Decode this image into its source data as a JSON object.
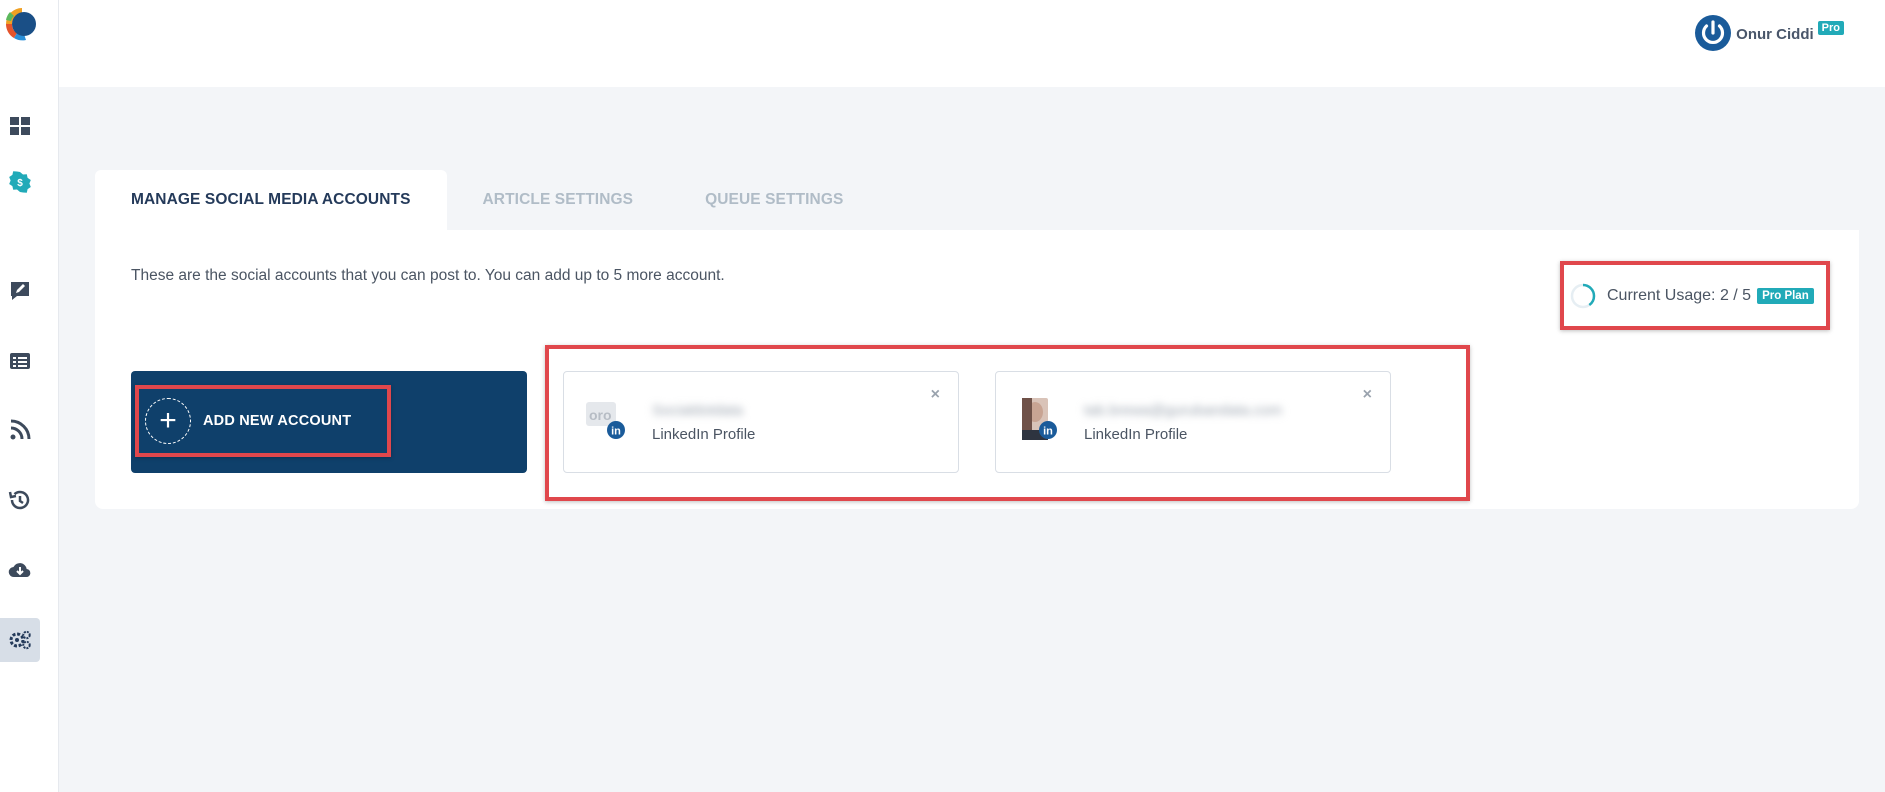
{
  "header": {
    "user_name": "Onur Ciddi",
    "user_badge": "Pro"
  },
  "sidebar": {
    "items": [
      {
        "name": "dashboard-icon"
      },
      {
        "name": "billing-icon"
      },
      {
        "name": "compose-icon"
      },
      {
        "name": "articles-icon"
      },
      {
        "name": "rss-icon"
      },
      {
        "name": "history-icon"
      },
      {
        "name": "download-icon"
      },
      {
        "name": "settings-icon",
        "active": true
      }
    ]
  },
  "tabs": [
    {
      "label": "MANAGE SOCIAL MEDIA ACCOUNTS",
      "active": true
    },
    {
      "label": "ARTICLE SETTINGS",
      "active": false
    },
    {
      "label": "QUEUE SETTINGS",
      "active": false
    }
  ],
  "panel": {
    "description": "These are the social accounts that you can post to. You can add up to 5 more account.",
    "usage_text": "Current Usage: 2 / 5",
    "usage_current": 2,
    "usage_max": 5,
    "plan_badge": "Pro Plan",
    "add_button_label": "ADD NEW ACCOUNT",
    "add_icon": "+",
    "close_icon": "×",
    "accounts": [
      {
        "name": "Socialdotdata",
        "type": "LinkedIn Profile"
      },
      {
        "name": "tab.brewa@gurubandata.com",
        "type": "LinkedIn Profile"
      }
    ]
  },
  "colors": {
    "primary": "#0f406b",
    "accent": "#21aab8",
    "highlight": "#e0474c"
  }
}
